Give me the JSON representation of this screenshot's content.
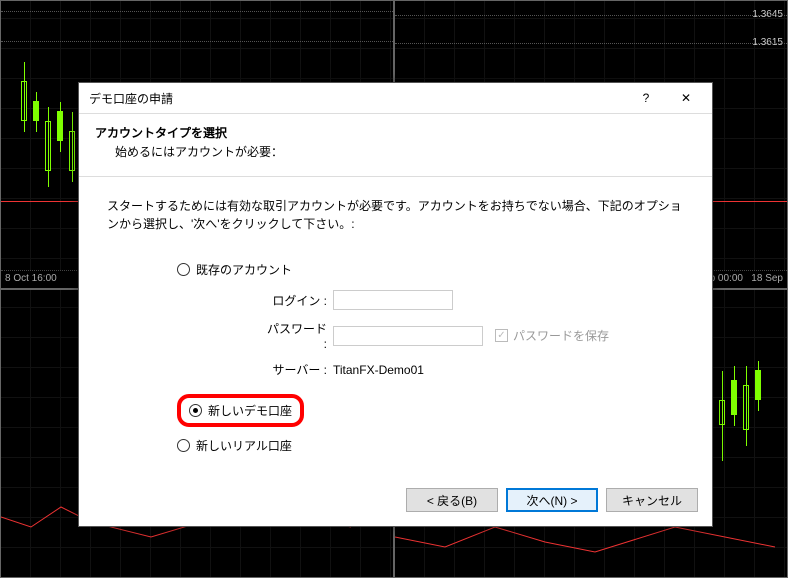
{
  "background": {
    "price_labels": [
      "1.3645",
      "1.3615"
    ],
    "time_labels": [
      "8 Oct 16:00",
      "p 00:00",
      "18 Sep"
    ]
  },
  "dialog": {
    "title": "デモ口座の申請",
    "help_symbol": "?",
    "close_symbol": "✕",
    "heading": "アカウントタイプを選択",
    "subheading": "始めるにはアカウントが必要：",
    "instructions": "スタートするためには有効な取引アカウントが必要です。アカウントをお持ちでない場合、下記のオプションから選択し、'次へ'をクリックして下さい。:",
    "radios": {
      "existing": "既存のアカウント",
      "new_demo": "新しいデモ口座",
      "new_real": "新しいリアル口座"
    },
    "fields": {
      "login_label": "ログイン :",
      "password_label": "パスワード :",
      "save_password_label": "パスワードを保存",
      "save_password_check": "✓",
      "server_label": "サーバー :",
      "server_value": "TitanFX-Demo01"
    },
    "buttons": {
      "back": "< 戻る(B)",
      "next": "次へ(N) >",
      "cancel": "キャンセル"
    }
  }
}
